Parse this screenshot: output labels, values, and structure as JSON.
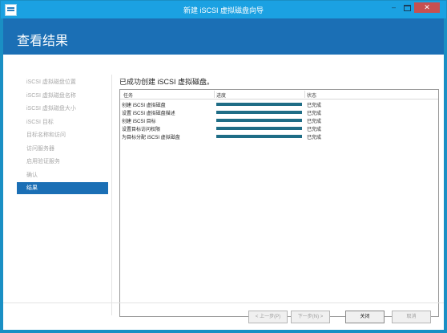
{
  "window": {
    "title": "新建 iSCSI 虚拟磁盘向导",
    "minimize_label": "–",
    "close_label": "✕"
  },
  "page": {
    "title": "查看结果",
    "status_heading": "已成功创建 iSCSI 虚拟磁盘。"
  },
  "nav": {
    "items": [
      {
        "label": "iSCSI 虚拟磁盘位置",
        "active": false
      },
      {
        "label": "iSCSI 虚拟磁盘名称",
        "active": false
      },
      {
        "label": "iSCSI 虚拟磁盘大小",
        "active": false
      },
      {
        "label": "iSCSI 目标",
        "active": false
      },
      {
        "label": "目标名称和访问",
        "active": false
      },
      {
        "label": "访问服务器",
        "active": false
      },
      {
        "label": "启用验证服务",
        "active": false
      },
      {
        "label": "确认",
        "active": false
      },
      {
        "label": "结果",
        "active": true
      }
    ]
  },
  "table": {
    "columns": {
      "task": "任务",
      "progress": "进度",
      "status": "状态"
    },
    "rows": [
      {
        "task": "创建 iSCSI 虚拟磁盘",
        "progress": 1.0,
        "status": "已完成"
      },
      {
        "task": "设置 iSCSI 虚拟磁盘描述",
        "progress": 1.0,
        "status": "已完成"
      },
      {
        "task": "创建 iSCSI 目标",
        "progress": 1.0,
        "status": "已完成"
      },
      {
        "task": "设置目标访问权限",
        "progress": 1.0,
        "status": "已完成"
      },
      {
        "task": "为目标分配 iSCSI 虚拟磁盘",
        "progress": 1.0,
        "status": "已完成"
      }
    ]
  },
  "buttons": {
    "prev": "< 上一步(P)",
    "next": "下一步(N) >",
    "close": "关闭",
    "cancel": "取消"
  },
  "colors": {
    "title_bar": "#1ba1e2",
    "header": "#1b6fb5",
    "progress_fill": "#1f6d86"
  }
}
